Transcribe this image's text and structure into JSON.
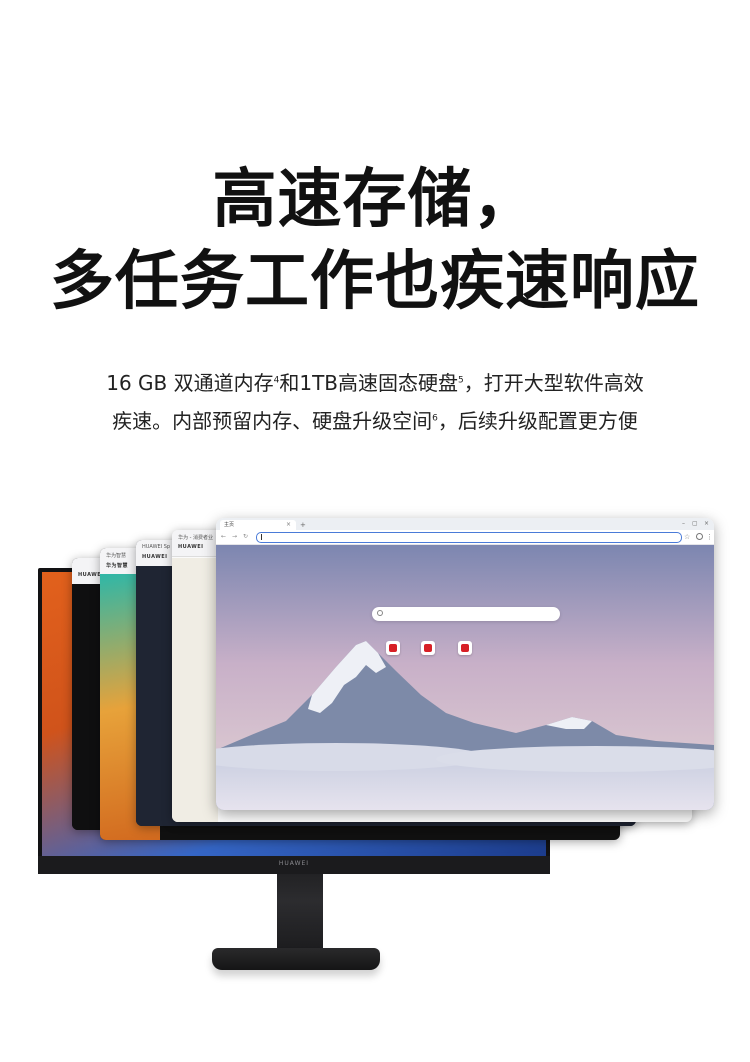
{
  "headline": {
    "line1": "高速存储，",
    "line2": "多任务工作也疾速响应"
  },
  "description": {
    "line1_a": "16 GB 双通道内存",
    "line1_sup1": "4",
    "line1_b": "和1TB高速固态硬盘",
    "line1_sup2": "5",
    "line1_c": "，打开大型软件高效",
    "line2_a": "疾速。内部预留内存、硬盘升级空间",
    "line2_sup": "6",
    "line2_b": "，后续升级配置更方便"
  },
  "monitor": {
    "brand": "HUAWEI"
  },
  "windows": {
    "w1": {
      "tab": "",
      "logo": "HUAWEI"
    },
    "w2": {
      "tab": "华为智慧",
      "logo": "华为智慧"
    },
    "w3": {
      "tab": "HUAWEI Sp",
      "logo": "HUAWEI"
    },
    "w4": {
      "tab": "华为 - 消费者业",
      "logo": "HUAWEI"
    }
  },
  "browser": {
    "tab_title": "主页",
    "url_value": ""
  },
  "icons": [
    "close-icon",
    "new-tab-icon",
    "back-icon",
    "forward-icon",
    "reload-icon",
    "star-icon",
    "profile-icon",
    "menu-icon",
    "search-icon",
    "huawei-shortcut-icon"
  ],
  "colors": {
    "headline": "#111111",
    "accent_url_border": "#4a7bd8",
    "huawei_red": "#d71f26"
  }
}
